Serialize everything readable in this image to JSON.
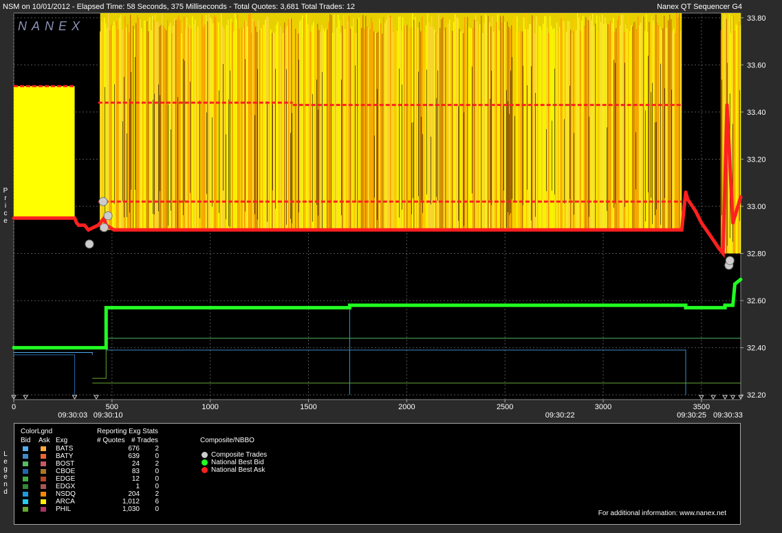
{
  "header": {
    "left": "NSM on 10/01/2012  -  Elapsed Time: 58 Seconds, 375 Milliseconds  -  Total Quotes: 3,681  Total Trades: 12",
    "right": "Nanex QT Sequencer G4"
  },
  "watermark": "NANEX",
  "side_labels": {
    "price": "Price",
    "legend": "Legend"
  },
  "chart_data": {
    "type": "line",
    "x_ticks": [
      0,
      500,
      1000,
      1500,
      2000,
      2500,
      3000,
      3500
    ],
    "x_range": [
      0,
      3700
    ],
    "y_range": [
      32.18,
      33.82
    ],
    "y_ticks": [
      "33.80",
      "33.60",
      "33.40",
      "33.20",
      "33.00",
      "32.80",
      "32.60",
      "32.40",
      "32.20"
    ],
    "time_labels": [
      {
        "x": 300,
        "label": "09:30:03"
      },
      {
        "x": 480,
        "label": "09:30:10"
      },
      {
        "x": 2780,
        "label": "09:30:22"
      },
      {
        "x": 3450,
        "label": "09:30:25"
      },
      {
        "x": 3635,
        "label": "09:30:33"
      }
    ],
    "grid": true,
    "series": [
      {
        "name": "National Best Bid",
        "color": "#22ff22",
        "points": [
          [
            0,
            32.4
          ],
          [
            470,
            32.4
          ],
          [
            470,
            32.57
          ],
          [
            1710,
            32.57
          ],
          [
            1710,
            32.58
          ],
          [
            3420,
            32.58
          ],
          [
            3420,
            32.57
          ],
          [
            3620,
            32.57
          ],
          [
            3620,
            32.58
          ],
          [
            3660,
            32.58
          ],
          [
            3670,
            32.67
          ],
          [
            3700,
            32.69
          ]
        ]
      },
      {
        "name": "National Best Ask",
        "color": "#ff2020",
        "points": [
          [
            0,
            32.95
          ],
          [
            310,
            32.95
          ],
          [
            320,
            32.93
          ],
          [
            330,
            32.92
          ],
          [
            360,
            32.92
          ],
          [
            380,
            32.9
          ],
          [
            430,
            32.92
          ],
          [
            460,
            32.95
          ],
          [
            470,
            32.92
          ],
          [
            510,
            32.9
          ],
          [
            3400,
            32.9
          ],
          [
            3420,
            33.06
          ],
          [
            3430,
            33.03
          ],
          [
            3470,
            32.98
          ],
          [
            3500,
            32.93
          ],
          [
            3550,
            32.87
          ],
          [
            3590,
            32.82
          ],
          [
            3610,
            32.8
          ],
          [
            3630,
            33.43
          ],
          [
            3660,
            32.93
          ],
          [
            3700,
            33.04
          ]
        ]
      }
    ],
    "secondary_ask_levels": [
      {
        "x0": 430,
        "x1": 3400,
        "y": 33.02
      },
      {
        "x0": 430,
        "x1": 1420,
        "y": 33.44
      },
      {
        "x0": 1420,
        "x1": 3400,
        "y": 33.43
      },
      {
        "x0": 0,
        "x1": 310,
        "y": 33.51
      }
    ],
    "composite_trades": [
      {
        "x": 385,
        "y": 32.84
      },
      {
        "x": 455,
        "y": 33.02
      },
      {
        "x": 460,
        "y": 32.91
      },
      {
        "x": 480,
        "y": 32.96
      },
      {
        "x": 3640,
        "y": 32.75
      },
      {
        "x": 3645,
        "y": 32.77
      }
    ],
    "yellow_block": {
      "x0": 0,
      "x1": 310,
      "y0": 32.95,
      "y1": 33.51
    },
    "busy_region": {
      "x0": 440,
      "x1": 3400,
      "y0": 32.9,
      "y1": 33.82
    },
    "end_region": {
      "x0": 3600,
      "x1": 3700,
      "y0": 32.8,
      "y1": 33.82
    }
  },
  "legend": {
    "title_left": "ColorLgnd",
    "title_stats": "Reporting Exg Stats",
    "col_bid": "Bid",
    "col_ask": "Ask",
    "col_exg": "Exg",
    "col_quotes": "# Quotes",
    "col_trades": "# Trades",
    "composite_title": "Composite/NBBO",
    "exchanges": [
      {
        "name": "BATS",
        "bid": "#55aaee",
        "ask": "#ffaa44",
        "quotes": "676",
        "trades": "2"
      },
      {
        "name": "BATY",
        "bid": "#4488cc",
        "ask": "#ee6633",
        "quotes": "639",
        "trades": "0"
      },
      {
        "name": "BOST",
        "bid": "#55bb66",
        "ask": "#cc5566",
        "quotes": "24",
        "trades": "2"
      },
      {
        "name": "CBOE",
        "bid": "#2266aa",
        "ask": "#aa7722",
        "quotes": "83",
        "trades": "0"
      },
      {
        "name": "EDGE",
        "bid": "#44aa44",
        "ask": "#bb4422",
        "quotes": "12",
        "trades": "0"
      },
      {
        "name": "EDGX",
        "bid": "#338833",
        "ask": "#aa5555",
        "quotes": "1",
        "trades": "0"
      },
      {
        "name": "NSDQ",
        "bid": "#2299dd",
        "ask": "#ff8800",
        "quotes": "204",
        "trades": "2"
      },
      {
        "name": "ARCA",
        "bid": "#22ccee",
        "ask": "#ffee00",
        "quotes": "1,012",
        "trades": "6"
      },
      {
        "name": "PHIL",
        "bid": "#66aa33",
        "ask": "#aa3366",
        "quotes": "1,030",
        "trades": "0"
      }
    ],
    "nbbo": [
      {
        "name": "Composite Trades",
        "color": "#cccccc"
      },
      {
        "name": "National Best Bid",
        "color": "#22ff22"
      },
      {
        "name": "National Best Ask",
        "color": "#ff2020"
      }
    ],
    "info": "For additional information: www.nanex.net"
  }
}
